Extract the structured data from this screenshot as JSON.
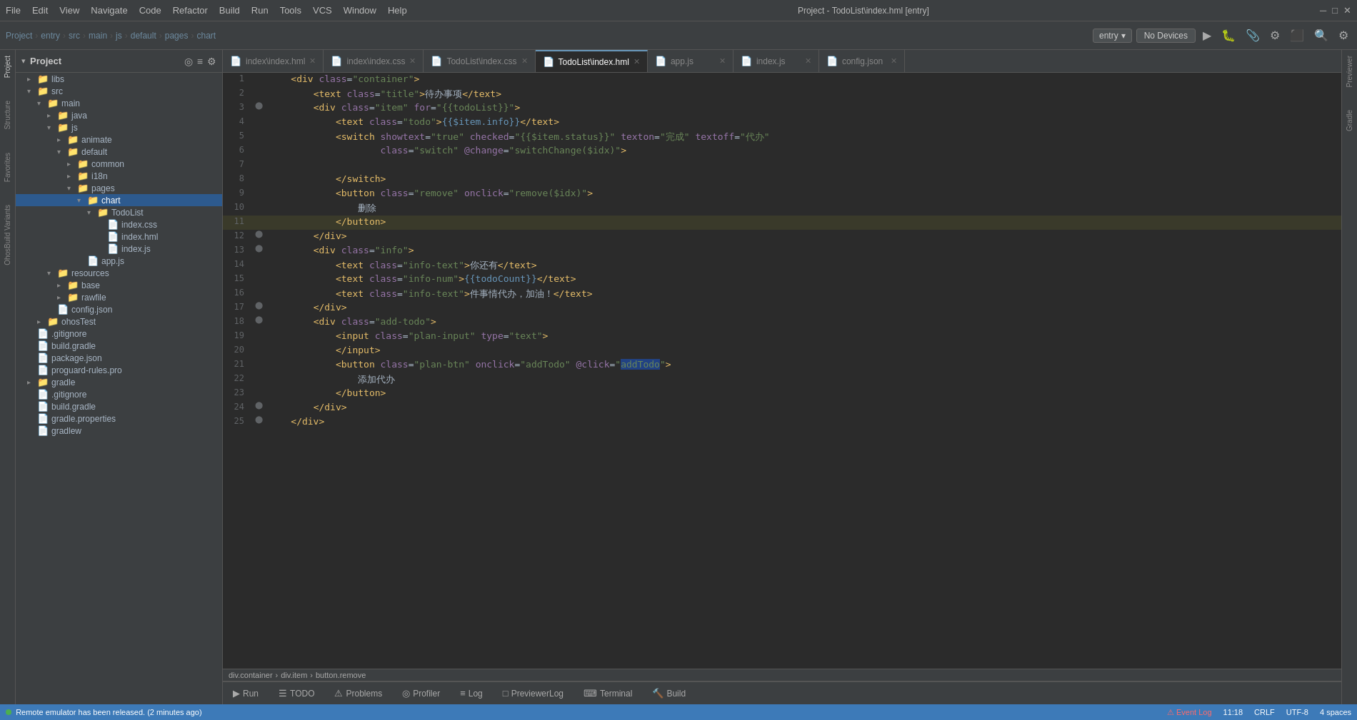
{
  "titleBar": {
    "menus": [
      "File",
      "Edit",
      "View",
      "Navigate",
      "Code",
      "Refactor",
      "Build",
      "Run",
      "Tools",
      "VCS",
      "Window",
      "Help"
    ],
    "projectTitle": "Project - TodoList\\index.hml [entry]"
  },
  "toolbar": {
    "breadcrumb": [
      "Project",
      "entry",
      "src",
      "main",
      "js",
      "default",
      "pages",
      "chart"
    ],
    "entryLabel": "entry",
    "noDevicesLabel": "No Devices"
  },
  "sidebar": {
    "title": "Project",
    "items": [
      {
        "label": "libs",
        "type": "folder",
        "indent": 1,
        "expanded": false
      },
      {
        "label": "src",
        "type": "folder",
        "indent": 1,
        "expanded": true
      },
      {
        "label": "main",
        "type": "folder",
        "indent": 2,
        "expanded": true
      },
      {
        "label": "java",
        "type": "folder",
        "indent": 3,
        "expanded": false
      },
      {
        "label": "js",
        "type": "folder",
        "indent": 3,
        "expanded": true
      },
      {
        "label": "animate",
        "type": "folder",
        "indent": 4,
        "expanded": true
      },
      {
        "label": "common",
        "type": "folder",
        "indent": 5,
        "expanded": false
      },
      {
        "label": "i18n",
        "type": "folder",
        "indent": 5,
        "expanded": false
      },
      {
        "label": "pages",
        "type": "folder",
        "indent": 5,
        "expanded": false
      },
      {
        "label": "app.js",
        "type": "js",
        "indent": 5
      },
      {
        "label": "default",
        "type": "folder",
        "indent": 4,
        "expanded": true
      },
      {
        "label": "common",
        "type": "folder",
        "indent": 5,
        "expanded": false
      },
      {
        "label": "i18n",
        "type": "folder",
        "indent": 5,
        "expanded": false
      },
      {
        "label": "pages",
        "type": "folder",
        "indent": 5,
        "expanded": true
      },
      {
        "label": "chart",
        "type": "folder",
        "indent": 6,
        "expanded": true,
        "selected": true
      },
      {
        "label": "TodoList",
        "type": "folder",
        "indent": 7,
        "expanded": true
      },
      {
        "label": "index.css",
        "type": "css",
        "indent": 8
      },
      {
        "label": "index.hml",
        "type": "hml",
        "indent": 8
      },
      {
        "label": "index.js",
        "type": "js",
        "indent": 8
      },
      {
        "label": "app.js",
        "type": "js",
        "indent": 6
      },
      {
        "label": "resources",
        "type": "folder",
        "indent": 3,
        "expanded": true
      },
      {
        "label": "base",
        "type": "folder",
        "indent": 4,
        "expanded": false
      },
      {
        "label": "rawfile",
        "type": "folder",
        "indent": 4,
        "expanded": false
      },
      {
        "label": "config.json",
        "type": "json",
        "indent": 3
      },
      {
        "label": "ohosTest",
        "type": "folder",
        "indent": 2,
        "expanded": false
      },
      {
        "label": ".gitignore",
        "type": "git",
        "indent": 1
      },
      {
        "label": "build.gradle",
        "type": "gradle",
        "indent": 1
      },
      {
        "label": "package.json",
        "type": "json",
        "indent": 1
      },
      {
        "label": "proguard-rules.pro",
        "type": "file",
        "indent": 1
      },
      {
        "label": "gradle",
        "type": "folder",
        "indent": 1,
        "expanded": false
      },
      {
        "label": ".gitignore",
        "type": "git",
        "indent": 1
      },
      {
        "label": "build.gradle",
        "type": "gradle",
        "indent": 1
      },
      {
        "label": "gradle.properties",
        "type": "gradle",
        "indent": 1
      },
      {
        "label": "gradlew",
        "type": "file",
        "indent": 1
      }
    ]
  },
  "tabs": [
    {
      "label": "index\\index.hml",
      "type": "hml",
      "active": false
    },
    {
      "label": "index\\index.css",
      "type": "css",
      "active": false
    },
    {
      "label": "TodoList\\index.css",
      "type": "css",
      "active": false
    },
    {
      "label": "TodoList\\index.hml",
      "type": "hml",
      "active": true
    },
    {
      "label": "app.js",
      "type": "js",
      "active": false
    },
    {
      "label": "index.js",
      "type": "js",
      "active": false
    },
    {
      "label": "config.json",
      "type": "json",
      "active": false
    }
  ],
  "codeLines": [
    {
      "num": 1,
      "content": "    <div class=\"container\">",
      "highlight": false
    },
    {
      "num": 2,
      "content": "        <text class=\"title\">待办事项</text>",
      "highlight": false
    },
    {
      "num": 3,
      "content": "        <div class=\"item\" for=\"{{todoList}}\">",
      "highlight": false,
      "gutter": true
    },
    {
      "num": 4,
      "content": "            <text class=\"todo\">{{$item.info}}</text>",
      "highlight": false
    },
    {
      "num": 5,
      "content": "            <switch showtext=\"true\" checked=\"{{$item.status}}\" texton=\"完成\" textoff=\"代办\"",
      "highlight": false
    },
    {
      "num": 6,
      "content": "                    class=\"switch\" @change=\"switchChange($idx)\">",
      "highlight": false
    },
    {
      "num": 7,
      "content": "",
      "highlight": false
    },
    {
      "num": 8,
      "content": "            </switch>",
      "highlight": false
    },
    {
      "num": 9,
      "content": "            <button class=\"remove\" onclick=\"remove($idx)\">",
      "highlight": false
    },
    {
      "num": 10,
      "content": "                删除",
      "highlight": false
    },
    {
      "num": 11,
      "content": "            </button>",
      "highlight": true
    },
    {
      "num": 12,
      "content": "        </div>",
      "highlight": false,
      "gutter": true
    },
    {
      "num": 13,
      "content": "        <div class=\"info\">",
      "highlight": false,
      "gutter": true
    },
    {
      "num": 14,
      "content": "            <text class=\"info-text\">你还有</text>",
      "highlight": false
    },
    {
      "num": 15,
      "content": "            <text class=\"info-num\">{{todoCount}}</text>",
      "highlight": false
    },
    {
      "num": 16,
      "content": "            <text class=\"info-text\">件事情代办，加油！</text>",
      "highlight": false
    },
    {
      "num": 17,
      "content": "        </div>",
      "highlight": false,
      "gutter": true
    },
    {
      "num": 18,
      "content": "        <div class=\"add-todo\">",
      "highlight": false,
      "gutter": true
    },
    {
      "num": 19,
      "content": "            <input class=\"plan-input\" type=\"text\">",
      "highlight": false
    },
    {
      "num": 20,
      "content": "            </input>",
      "highlight": false
    },
    {
      "num": 21,
      "content": "            <button class=\"plan-btn\" onclick=\"addTodo\" @click=\"addTodo\">",
      "highlight": false
    },
    {
      "num": 22,
      "content": "                添加代办",
      "highlight": false
    },
    {
      "num": 23,
      "content": "            </button>",
      "highlight": false
    },
    {
      "num": 24,
      "content": "        </div>",
      "highlight": false,
      "gutter": true
    },
    {
      "num": 25,
      "content": "    </div>",
      "highlight": false,
      "gutter": true
    }
  ],
  "breadcrumb": {
    "path": "div.container > div.item > button.remove"
  },
  "bottomTabs": [
    {
      "label": "Run",
      "icon": "▶",
      "active": false
    },
    {
      "label": "TODO",
      "icon": "☰",
      "active": false
    },
    {
      "label": "Problems",
      "icon": "⚠",
      "active": false
    },
    {
      "label": "Profiler",
      "icon": "◎",
      "active": false
    },
    {
      "label": "Log",
      "icon": "≡",
      "active": false
    },
    {
      "label": "PreviewerLog",
      "icon": "□",
      "active": false
    },
    {
      "label": "Terminal",
      "icon": "⌨",
      "active": false
    },
    {
      "label": "Build",
      "icon": "🔨",
      "active": false
    }
  ],
  "statusBar": {
    "leftText": "Remote emulator has been released. (2 minutes ago)",
    "time": "11:18",
    "encoding": "CRLF",
    "charset": "UTF-8",
    "spaces": "4 spaces",
    "eventLog": "Event Log"
  },
  "activityBar": {
    "items": [
      "Project",
      "Structure",
      "Favorites",
      "OhosBuild Variants"
    ]
  }
}
